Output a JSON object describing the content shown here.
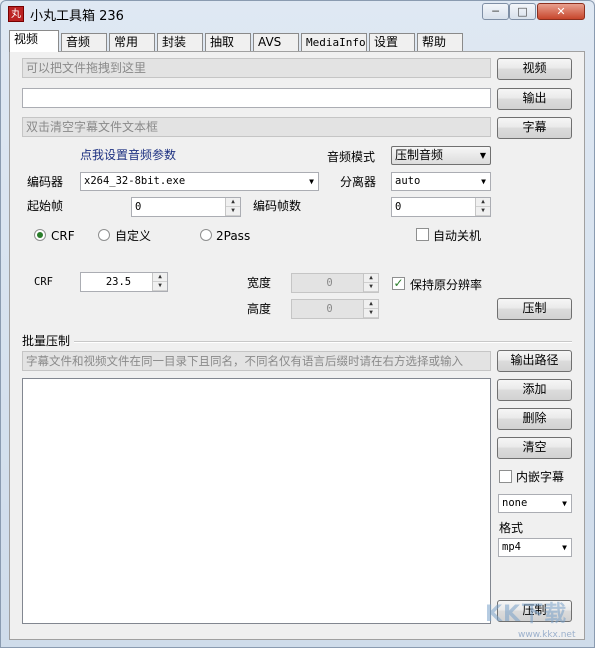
{
  "window": {
    "title": "小丸工具箱 236",
    "icon_text": "丸"
  },
  "controls": {
    "minimize": "─",
    "maximize": "□",
    "close": "✕"
  },
  "tabs": [
    "视频",
    "音频",
    "常用",
    "封装",
    "抽取",
    "AVS",
    "MediaInfo",
    "设置",
    "帮助"
  ],
  "active_tab": "视频",
  "top": {
    "video_placeholder": "可以把文件拖拽到这里",
    "output_value": "",
    "subtitle_placeholder": "双击清空字幕文件文本框",
    "video_button": "视频",
    "output_button": "输出",
    "subtitle_button": "字幕"
  },
  "audio": {
    "link": "点我设置音频参数",
    "mode_label": "音频模式",
    "mode_value": "压制音频"
  },
  "encoder": {
    "label": "编码器",
    "value": "x264_32-8bit.exe",
    "splitter_label": "分离器",
    "splitter_value": "auto",
    "start_frame_label": "起始帧",
    "start_frame_value": "0",
    "frames_label": "编码帧数",
    "frames_value": "0"
  },
  "ratecontrol": {
    "options": [
      "CRF",
      "自定义",
      "2Pass"
    ],
    "selected": "CRF",
    "auto_shutdown_label": "自动关机",
    "auto_shutdown": false,
    "crf_label": "CRF",
    "crf_value": "23.5",
    "width_label": "宽度",
    "width_value": "0",
    "height_label": "高度",
    "height_value": "0",
    "keep_res_label": "保持原分辨率",
    "keep_res": true,
    "encode_button": "压制"
  },
  "batch": {
    "section_label": "批量压制",
    "hint": "字幕文件和视频文件在同一目录下且同名，不同名仅有语言后缀时请在右方选择或输入",
    "output_path_button": "输出路径",
    "add_button": "添加",
    "delete_button": "删除",
    "clear_button": "清空",
    "embed_sub_label": "内嵌字幕",
    "embed_sub": false,
    "sub_lang_value": "none",
    "format_label": "格式",
    "format_value": "mp4",
    "encode_button": "压制",
    "items": []
  },
  "watermark": {
    "text": "KK下载",
    "url": "www.kkx.net"
  },
  "colors": {
    "accent_green": "#2a7d2a",
    "link_blue": "#1b2f80",
    "close_red": "#c7462c"
  }
}
